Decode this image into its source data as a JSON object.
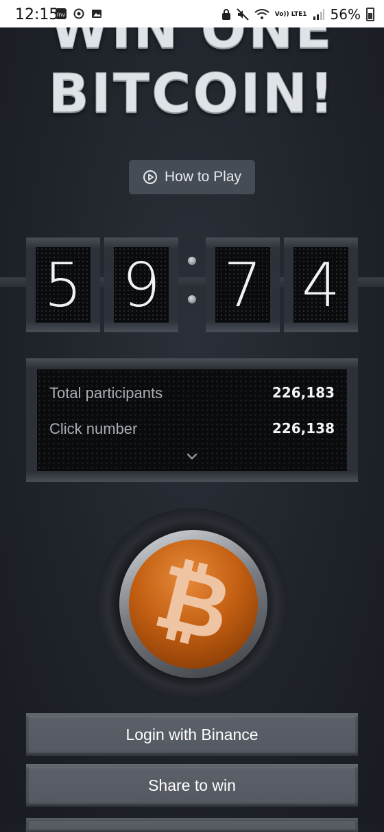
{
  "status_bar": {
    "time": "12:15",
    "network": "Vo)) LTE1",
    "battery": "56%",
    "left_icons": [
      "inv-app-icon",
      "sync-icon",
      "image-icon"
    ],
    "right_icons": [
      "lock-icon",
      "mute-icon",
      "wifi-icon",
      "signal-icon",
      "battery-icon"
    ]
  },
  "title": {
    "line1": "WIN ONE",
    "line2": "BITCOIN!"
  },
  "how_to_play": {
    "label": "How to Play",
    "icon": "play-circle-icon"
  },
  "counter": {
    "digits": [
      "5",
      "9",
      "7",
      "4"
    ]
  },
  "stats": {
    "rows": [
      {
        "label": "Total participants",
        "value": "226,183"
      },
      {
        "label": "Click number",
        "value": "226,138"
      }
    ],
    "expand_icon": "chevron-down-icon"
  },
  "main_button": {
    "icon": "bitcoin-icon",
    "symbol": "₿"
  },
  "actions": {
    "login": "Login with Binance",
    "share": "Share to win"
  },
  "colors": {
    "background": "#1f232a",
    "button_orange": "#c35f12",
    "action_button": "#5b6068"
  }
}
